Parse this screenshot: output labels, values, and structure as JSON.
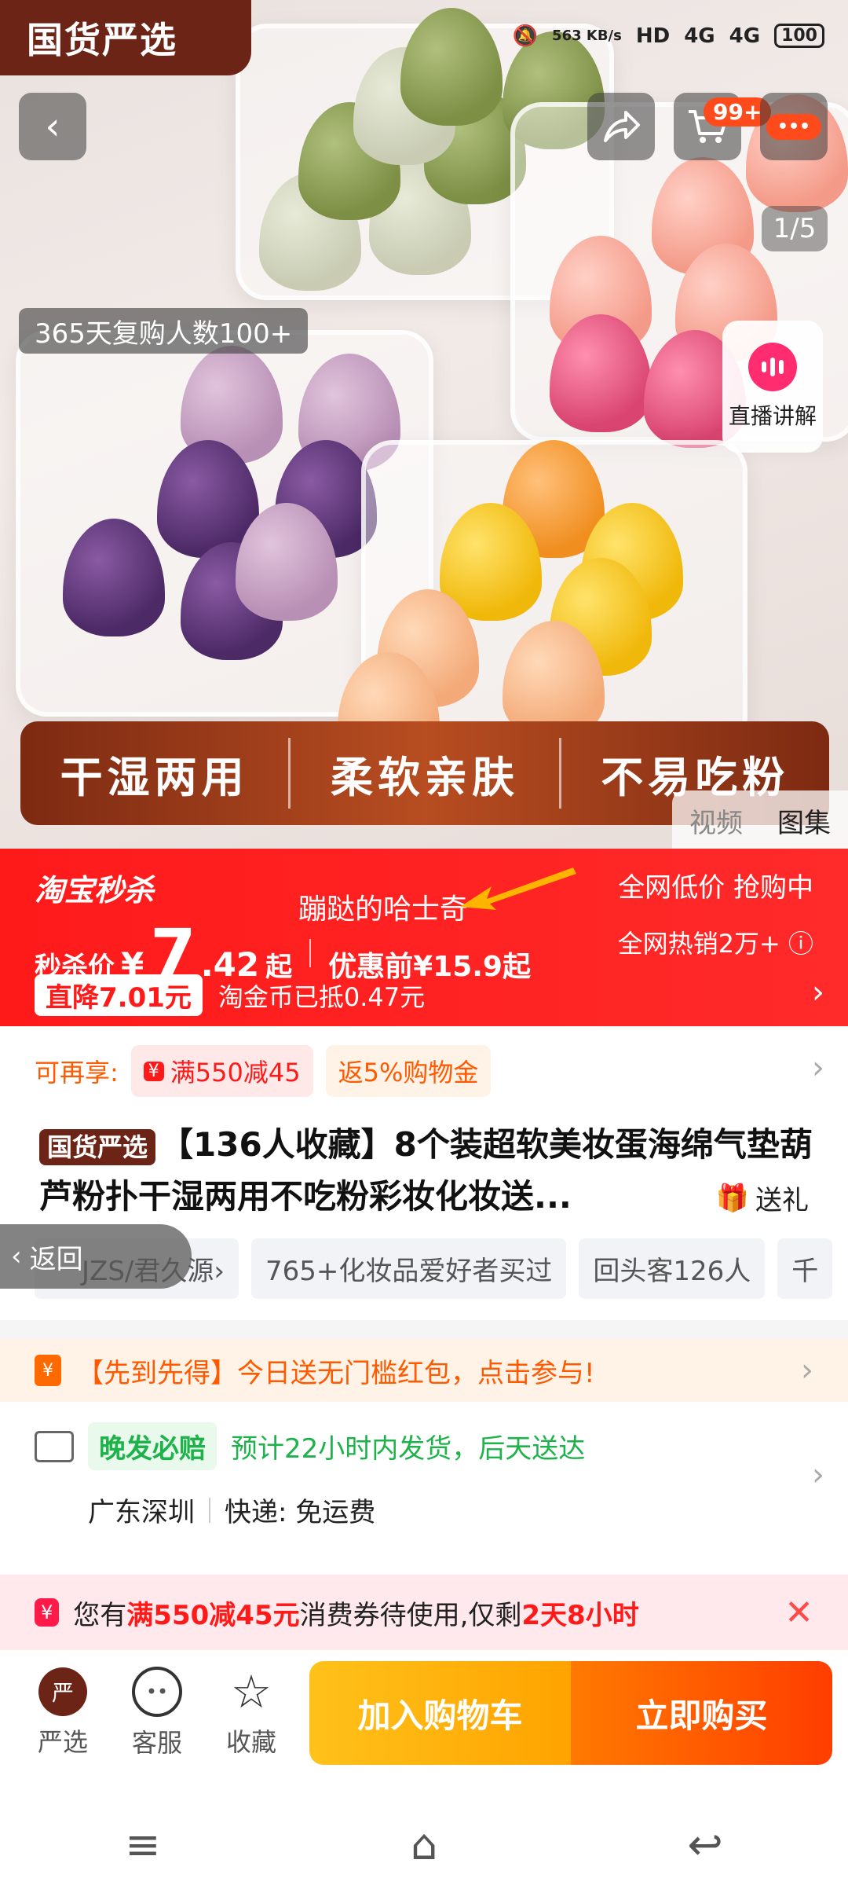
{
  "status_bar": {
    "brand": "国货严选",
    "speed": "563 KB/s",
    "net1": "HD",
    "net2": "4G",
    "net3": "4G",
    "battery": "100"
  },
  "header": {
    "cart_badge": "99+",
    "image_counter": "1/5",
    "repurchase": "365天复购人数100+",
    "live_label": "直播讲解"
  },
  "features": [
    "干湿两用",
    "柔软亲肤",
    "不易吃粉"
  ],
  "media_tabs": {
    "video": "视频",
    "gallery": "图集"
  },
  "price": {
    "seckill_label": "淘宝秒杀",
    "husky": "蹦跶的哈士奇",
    "price_label": "秒杀价",
    "currency": "¥",
    "int_part": "7",
    "dec_part": ".42",
    "suffix": "起",
    "before": "优惠前¥15.9起",
    "right_top": "全网低价 抢购中",
    "right_bottom": "全网热销2万+ ⓘ",
    "drop": "直降7.01元",
    "coin": "淘金币已抵0.47元"
  },
  "offers": {
    "label": "可再享:",
    "tag1_icon": "¥",
    "tag1": "满550减45",
    "tag2": "返5%购物金"
  },
  "product": {
    "brand_tag": "国货严选",
    "title": "【136人收藏】8个装超软美妆蛋海绵气垫葫芦粉扑干湿两用不吃粉彩妆化妆送...",
    "gift": "送礼"
  },
  "chips": [
    "JZS/君久源›",
    "765+化妆品爱好者买过",
    "回头客126人",
    "千"
  ],
  "back_label": "返回",
  "promo": {
    "text": "【先到先得】今日送无门槛红包，点击参与!"
  },
  "shipping": {
    "late_tag": "晚发必赔",
    "eta": "预计22小时内发货，后天送达",
    "origin": "广东深圳",
    "express": "快递: 免运费"
  },
  "coupon": {
    "pre": "您有",
    "hl1": "满550减45元",
    "mid": "消费券待使用,仅剩",
    "hl2": "2天8小时"
  },
  "bottom_bar": {
    "store": "严选",
    "service": "客服",
    "favorite": "收藏",
    "add_cart": "加入购物车",
    "buy_now": "立即购买"
  }
}
